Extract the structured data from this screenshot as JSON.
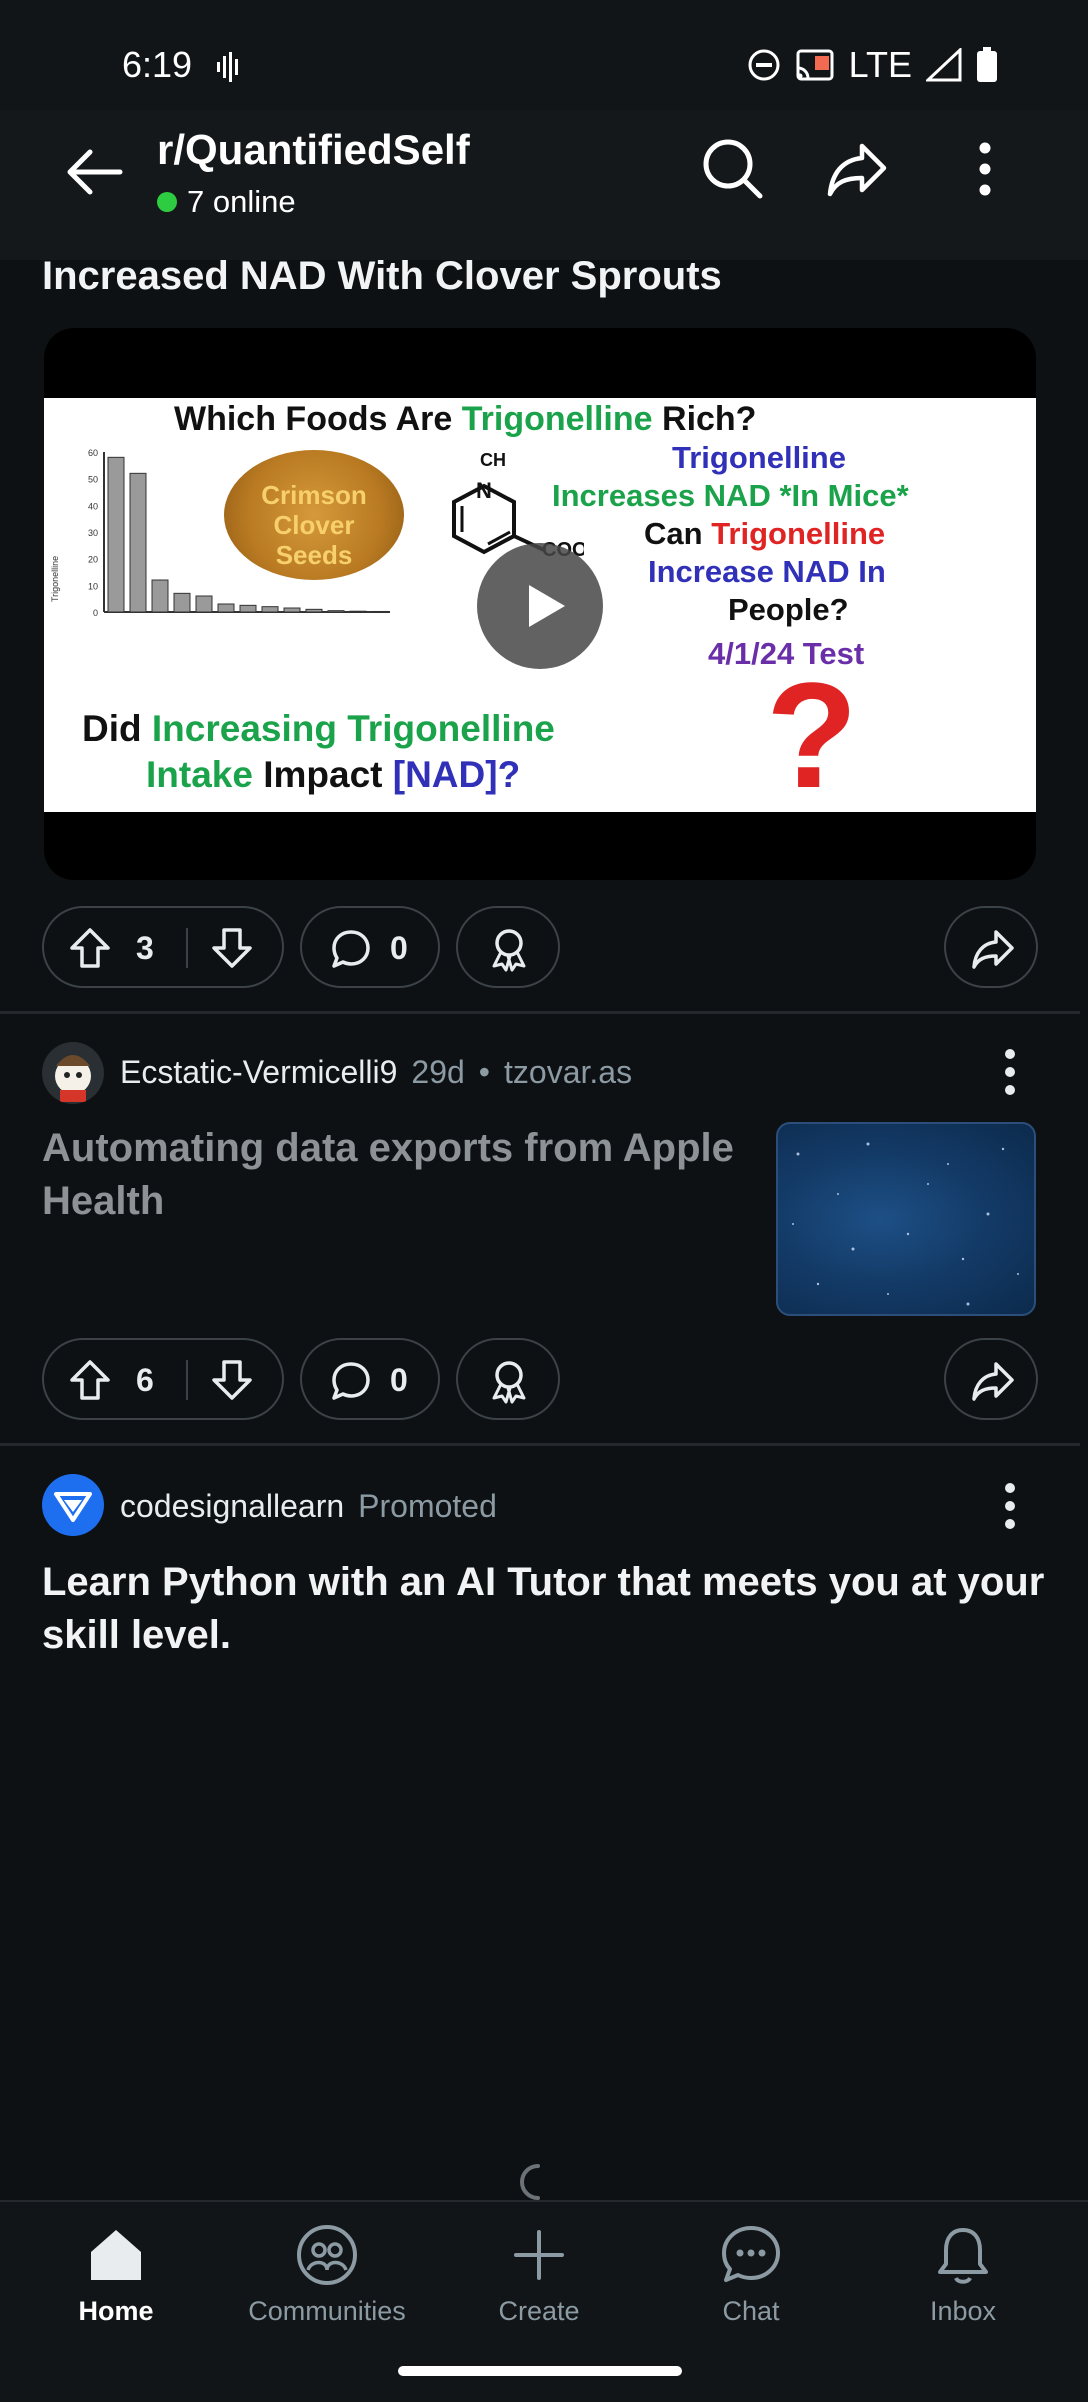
{
  "status_bar": {
    "time": "6:19",
    "network": "LTE"
  },
  "header": {
    "subreddit": "r/QuantifiedSelf",
    "online": "7 online"
  },
  "post1": {
    "title": "Increased NAD With Clover Sprouts",
    "thumbnail": {
      "heading_pre": "Which Foods Are ",
      "heading_hl": "Trigonelline",
      "heading_post": " Rich?",
      "seed_label": [
        "Crimson",
        "Clover",
        "Seeds"
      ],
      "right_lines": {
        "l1": "Trigonelline",
        "l2": "Increases NAD *In Mice*",
        "l3a": "Can ",
        "l3b": "Trigonelline",
        "l4": "Increase NAD In",
        "l5": "People?",
        "l6": "4/1/24 Test"
      },
      "bottom": {
        "b1a": "Did ",
        "b1b": "Increasing Trigonelline",
        "b2a": "Intake ",
        "b2b": "Impact ",
        "b2c": "[NAD]?"
      },
      "question_mark": "?",
      "chart_caption": "Trigonelline",
      "chart_bar_values": [
        58,
        52,
        12,
        7,
        6,
        3,
        2.5,
        2,
        1.5,
        1,
        0.5,
        0.3,
        0.2
      ],
      "chart_y_ticks": [
        "60",
        "50",
        "40",
        "30",
        "20",
        "10",
        "0"
      ]
    },
    "actions": {
      "upvotes": "3",
      "comments": "0"
    }
  },
  "post2": {
    "author": "Ecstatic-Vermicelli9",
    "age": "29d",
    "domain": "tzovar.as",
    "title": "Automating data exports from Apple Health",
    "actions": {
      "upvotes": "6",
      "comments": "0"
    }
  },
  "ad": {
    "author": "codesignallearn",
    "tag": "Promoted",
    "title": "Learn Python with an AI Tutor that meets you at your skill level."
  },
  "bottom_nav": [
    {
      "label": "Home",
      "icon": "home-icon",
      "active": true
    },
    {
      "label": "Communities",
      "icon": "communities-icon"
    },
    {
      "label": "Create",
      "icon": "plus-icon"
    },
    {
      "label": "Chat",
      "icon": "chat-icon"
    },
    {
      "label": "Inbox",
      "icon": "bell-icon"
    }
  ],
  "colors": {
    "bg": "#0e1113",
    "accent_green": "#2ecc40",
    "trig_green": "#1aa34a",
    "red": "#e02424",
    "blue": "#3030b8",
    "purple": "#6a2fa8"
  }
}
